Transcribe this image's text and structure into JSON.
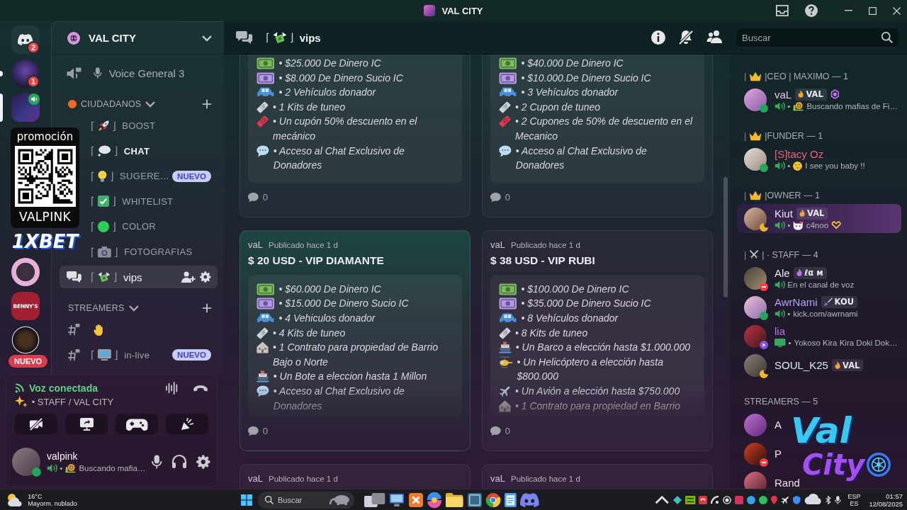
{
  "title_bar": {
    "title": "VAL CITY"
  },
  "server_rail": {
    "upper": [
      {
        "kind": "home",
        "badge": "2",
        "selected": false
      },
      {
        "kind": "picture",
        "badge": "1",
        "selected": false,
        "unread": true
      },
      {
        "kind": "picture",
        "selected": true,
        "in_voice": true
      }
    ],
    "lower": [
      {
        "kind": "picture",
        "selected": false
      },
      {
        "kind": "logo",
        "label": "BENNY'S",
        "selected": false
      },
      {
        "kind": "picture",
        "selected": false,
        "tag": "NUEVO"
      }
    ]
  },
  "promo_overlay": {
    "heading": "promoción",
    "code": "VALPINK",
    "brand": "1XBET"
  },
  "channel_sidebar": {
    "server_name": "VAL CITY",
    "voice_channels": [
      {
        "kind": "mic",
        "name": "Voice General 3"
      }
    ],
    "categories": [
      {
        "name": "CIUDADANOS",
        "kind": "dot",
        "channels": [
          {
            "kind": "rocket",
            "open": "⌈",
            "close": "⌋",
            "name": "BOOST",
            "selected": false,
            "unread": false
          },
          {
            "kind": "thought",
            "open": "⌈",
            "close": "⌋",
            "name": "CHAT",
            "selected": false,
            "unread": true
          },
          {
            "kind": "bulb",
            "open": "⌈",
            "close": "⌋",
            "name": "SUGERE…",
            "selected": false,
            "unread": false,
            "badge": "NUEVO"
          },
          {
            "kind": "check",
            "open": "⌈",
            "close": "⌋",
            "name": "WHITELIST",
            "selected": false,
            "unread": false
          },
          {
            "kind": "green_circle",
            "open": "⌈",
            "close": "⌋",
            "name": "COLOR",
            "selected": false,
            "unread": false
          },
          {
            "kind": "camera",
            "open": "⌈",
            "close": "⌋",
            "name": "FOTOGRAFIAS",
            "selected": false,
            "unread": false
          },
          {
            "kind": "money",
            "type": {
              "kind": "forum"
            },
            "open": "⌈",
            "close": "⌋",
            "name": "vips",
            "selected": true,
            "unread": false
          }
        ]
      },
      {
        "name": "STREAMERS",
        "kind": "plain",
        "channels": [
          {
            "kind": "hand",
            "type": {
              "kind": "locked"
            },
            "selected": false
          },
          {
            "kind": "tv",
            "type": {
              "kind": "locked"
            },
            "open": "⌈",
            "close": "⌋",
            "name": "in-live",
            "selected": false,
            "unread": false,
            "badge": "NUEVO"
          }
        ]
      }
    ]
  },
  "voice_panel": {
    "title": "Voz conectada",
    "channel": "• STAFF / VAL CITY",
    "actions": [
      {
        "kind": "camera_off"
      },
      {
        "kind": "screen_share"
      },
      {
        "kind": "activity"
      },
      {
        "kind": "soundboard"
      }
    ]
  },
  "user_panel": {
    "name": "valpink",
    "status": {
      "kind": "online"
    },
    "activity": {
      "lead": {
        "kind": "voice"
      },
      "sep": "•",
      "kind": "snail",
      "text": "Buscando mafia…"
    }
  },
  "channel_header": {
    "open": "⌈",
    "kind": "money",
    "close": "⌋",
    "name": "vips"
  },
  "member_search": {
    "placeholder": "Buscar"
  },
  "posts": [
    {
      "hovered": false,
      "perks": [
        {
          "kind": "cash",
          "text": "• $25.000 De Dinero IC"
        },
        {
          "kind": "dirty",
          "text": "• $8.000 De Dinero Sucio IC"
        },
        {
          "kind": "car",
          "text": "• 2 Vehículos donador"
        },
        {
          "kind": "kit",
          "text": "• 1 Kits de tuneo"
        },
        {
          "kind": "coupon",
          "text": "• Un cupón 50% descuento en el mecánico"
        },
        {
          "kind": "chat",
          "text": "• Acceso al Chat Exclusivo de Donadores"
        }
      ],
      "replies": "0"
    },
    {
      "hovered": false,
      "perks": [
        {
          "kind": "cash",
          "text": "• $40.000 De Dinero IC"
        },
        {
          "kind": "dirty",
          "text": "• $10.000.De Dinero Sucio IC"
        },
        {
          "kind": "car",
          "text": "• 3 Vehículos donador"
        },
        {
          "kind": "kit",
          "text": "• 2 Cupon de tuneo"
        },
        {
          "kind": "coupon",
          "text": "• 2 Cupones de 50% de descuento en el Mecanico"
        },
        {
          "kind": "chat",
          "text": "• Acceso al Chat Exclusivo de Donadores"
        }
      ],
      "replies": "0"
    },
    {
      "author": "vaL",
      "time": "Publicado hace 1 d",
      "title": "$ 20 USD - VIP DIAMANTE",
      "hovered": true,
      "perks": [
        {
          "kind": "cash",
          "text": "• $60.000 De Dinero IC"
        },
        {
          "kind": "dirty",
          "text": "• $15.000 De Dinero Sucio IC"
        },
        {
          "kind": "car",
          "text": "• 4 Vehiculos donador"
        },
        {
          "kind": "kit",
          "text": "• 4 Kits de tuneo"
        },
        {
          "kind": "house",
          "text": "• 1 Contrato para propiedad de Barrio Bajo o Norte"
        },
        {
          "kind": "boat",
          "text": "• Un Bote a eleccion hasta 1 Millon"
        },
        {
          "kind": "chat",
          "text": "• Acceso al Chat Exclusivo de Donadores"
        }
      ],
      "replies": "0"
    },
    {
      "author": "vaL",
      "time": "Publicado hace 1 d",
      "title": "$ 38 USD - VIP RUBI",
      "hovered": false,
      "perks": [
        {
          "kind": "cash",
          "text": "• $100.000 De Dinero IC"
        },
        {
          "kind": "dirty",
          "text": "• $35.000 De Dinero Sucio IC"
        },
        {
          "kind": "car",
          "text": "• 8 Vehículos donador"
        },
        {
          "kind": "kit",
          "text": "• 8 Kits de tuneo"
        },
        {
          "kind": "boat",
          "text": "• Un Barco a elección hasta $1.000.000"
        },
        {
          "kind": "heli",
          "text": "• Un Helicóptero a elección hasta $800.000"
        },
        {
          "kind": "plane",
          "text": "• Un Avión a elección hasta $750.000"
        },
        {
          "kind": "house",
          "text": "• 1 Contrato para propiedad en Barrio"
        }
      ],
      "replies": "0"
    },
    {
      "author": "vaL",
      "time": "Publicado hace 1 d",
      "hovered": false
    },
    {
      "author": "vaL",
      "time": "Publicado hace 1 d",
      "hovered": false
    }
  ],
  "member_list": {
    "groups": [
      {
        "lead": "|",
        "kind": "crown",
        "title": "|CEO | MAXIMO — 1",
        "members": [
          {
            "name": "vaL",
            "color": "#e2c4ec",
            "status": {
              "kind": "online"
            },
            "badge": {
              "kind": "fire",
              "label": "VAL"
            },
            "extra": {
              "kind": "hexagon"
            },
            "activity": {
              "lead": {
                "kind": "voice"
              },
              "sep": "•",
              "kind": "snail",
              "text": "Buscando mafias de Fi…"
            }
          }
        ]
      },
      {
        "lead": "|",
        "kind": "crown",
        "title": "|FUNDER — 1",
        "members": [
          {
            "name": "[S]tacy Oz",
            "color": "#ee5f82",
            "status": {
              "kind": "online"
            },
            "activity": {
              "lead": {
                "kind": "voice"
              },
              "sep": "•",
              "kind": "kiss",
              "text": "I see you baby !!"
            }
          }
        ]
      },
      {
        "lead": "|",
        "kind": "crown",
        "title": "|OWNER — 1",
        "members": [
          {
            "name": "Kiut",
            "color": "#ece4f4",
            "status": {
              "kind": "idle"
            },
            "nameplate": true,
            "badge": {
              "kind": "fire",
              "label": "VAL"
            },
            "activity": {
              "lead": {
                "kind": "voice"
              },
              "sep": "•",
              "kind": "kitty",
              "text": "c4noo",
              "after": {
                "kind": "heart_hands"
              }
            }
          }
        ]
      },
      {
        "lead": "|",
        "kind": "swords",
        "title": "| · STAFF — 4",
        "members": [
          {
            "name": "Ale",
            "color": "#ece6ee",
            "status": {
              "kind": "dnd"
            },
            "badge": {
              "kind": "fire_purple",
              "label": "ℓα м"
            },
            "activity": {
              "lead": {
                "kind": "voice"
              },
              "text": "En el canal de voz"
            }
          },
          {
            "name": "AwrNami",
            "color": "#b9a0f2",
            "status": {
              "kind": "online"
            },
            "badge": {
              "kind": "sword",
              "label": "KOU"
            },
            "activity": {
              "lead": {
                "kind": "voice"
              },
              "sep": "•",
              "text": "kick.com/awrnami"
            }
          },
          {
            "name": "lia",
            "color": "#b67ae6",
            "status": {
              "kind": "streaming"
            },
            "activity": {
              "lead": {
                "kind": "screen"
              },
              "sep": "•",
              "text": "Yokoso Kira Kira Doki Dok…"
            }
          },
          {
            "name": "SOUL_K25",
            "color": "#d4ecef",
            "status": {
              "kind": "idle"
            },
            "badge": {
              "kind": "fire",
              "label": "VAL"
            }
          }
        ]
      },
      {
        "title": "STREAMERS — 5",
        "members": [
          {
            "name": "A",
            "color": "#e4e4ea"
          },
          {
            "name": "P",
            "color": "#e4e4ea",
            "status": {
              "kind": "dnd"
            }
          },
          {
            "name": "Rand",
            "color": "#e4e4ea"
          }
        ]
      }
    ]
  },
  "logo_overlay": {
    "top": "Val",
    "bottom": "City"
  },
  "taskbar": {
    "weather": {
      "temperature": "16°C",
      "condition": "Mayorm. nublado"
    },
    "search": {
      "placeholder": "Buscar"
    },
    "apps": [
      {
        "kind": "task_view"
      },
      {
        "kind": "monitor"
      },
      {
        "kind": "cross_tile"
      },
      {
        "kind": "swirl"
      },
      {
        "kind": "folder"
      },
      {
        "kind": "tile"
      },
      {
        "kind": "ring"
      },
      {
        "kind": "notepad"
      },
      {
        "kind": "controller"
      }
    ],
    "tray": [
      {
        "kind": "chevron"
      },
      {
        "kind": "diamond"
      },
      {
        "kind": "chip"
      },
      {
        "kind": "swirl"
      },
      {
        "kind": "arc"
      },
      {
        "kind": "record"
      },
      {
        "kind": "square"
      },
      {
        "kind": "bubble"
      },
      {
        "kind": "dot"
      },
      {
        "kind": "pin"
      },
      {
        "kind": "plane"
      },
      {
        "kind": "shield"
      },
      {
        "kind": "cloud"
      },
      {
        "kind": "bluetooth"
      },
      {
        "kind": "mic"
      }
    ],
    "language": "ESP",
    "region": "ES",
    "time": "01:57",
    "date": "12/08/2025"
  }
}
